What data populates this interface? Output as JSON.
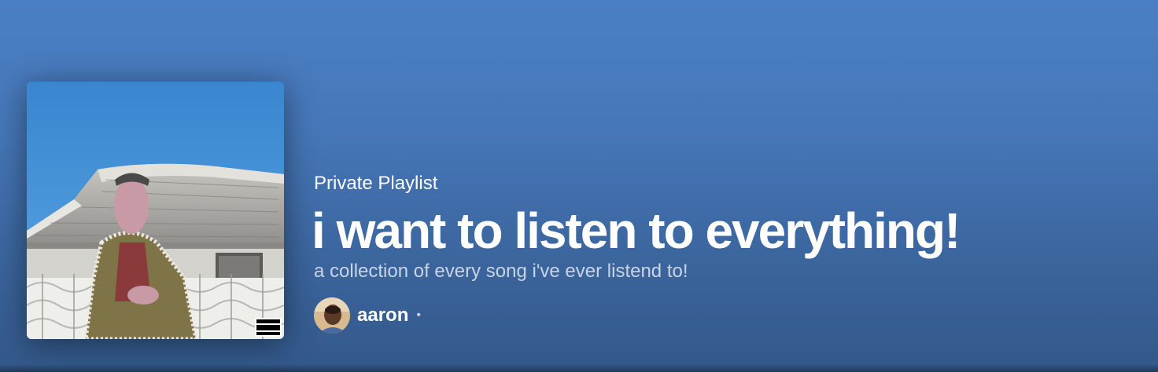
{
  "playlist": {
    "type_label": "Private Playlist",
    "title": "i want to listen to everything!",
    "description": "a collection of every song i've ever listend to!",
    "owner": "aaron",
    "separator": "•"
  },
  "cover": {
    "explicit_badge_text": "PARENTAL ADVISORY EXPLICIT CONTENT"
  },
  "colors": {
    "header_top": "#4b7fc4",
    "header_bottom": "#33588a",
    "text_primary": "#ffffff",
    "text_secondary": "rgba(255,255,255,0.72)"
  }
}
